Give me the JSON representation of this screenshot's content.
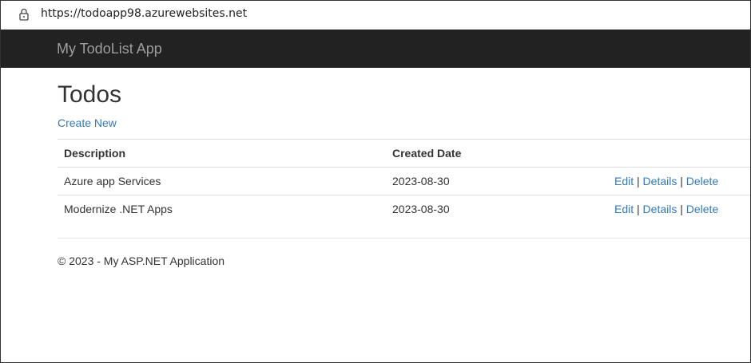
{
  "browser": {
    "url": "https://todoapp98.azurewebsites.net",
    "lock_icon": "lock-icon"
  },
  "navbar": {
    "brand": "My TodoList App"
  },
  "page": {
    "title": "Todos",
    "create_new": "Create New"
  },
  "table": {
    "headers": [
      "Description",
      "Created Date"
    ],
    "rows": [
      {
        "description": "Azure app Services",
        "created": "2023-08-30"
      },
      {
        "description": "Modernize .NET Apps",
        "created": "2023-08-30"
      }
    ],
    "actions": {
      "edit": "Edit",
      "details": "Details",
      "delete": "Delete",
      "separator": "|"
    }
  },
  "footer": {
    "text": "© 2023 - My ASP.NET Application"
  },
  "colors": {
    "navbar_bg": "#222222",
    "brand": "#9d9d9d",
    "link": "#337ab7"
  }
}
